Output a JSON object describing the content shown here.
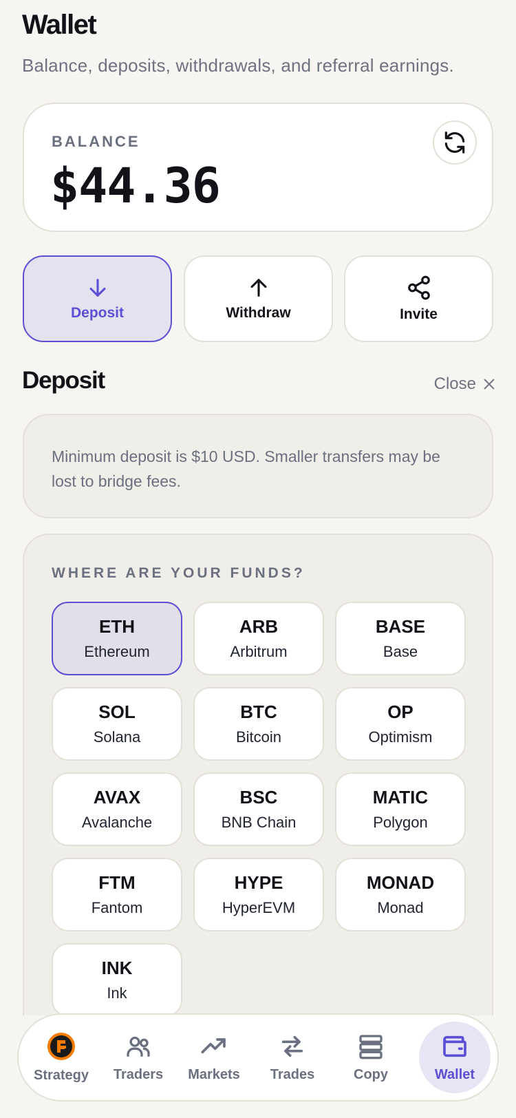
{
  "header": {
    "title": "Wallet",
    "subtitle": "Balance, deposits, withdrawals, and referral earnings."
  },
  "balance": {
    "label": "BALANCE",
    "amount": "$44.36",
    "refresh_icon": "refresh-icon"
  },
  "actions": [
    {
      "label": "Deposit",
      "icon": "arrow-down-icon",
      "active": true
    },
    {
      "label": "Withdraw",
      "icon": "arrow-up-icon",
      "active": false
    },
    {
      "label": "Invite",
      "icon": "share-icon",
      "active": false
    }
  ],
  "deposit": {
    "title": "Deposit",
    "close_label": "Close",
    "notice": "Minimum deposit is $10 USD. Smaller transfers may be lost to bridge fees.",
    "funds_label": "WHERE ARE YOUR FUNDS?",
    "chains": [
      {
        "symbol": "ETH",
        "name": "Ethereum",
        "selected": true
      },
      {
        "symbol": "ARB",
        "name": "Arbitrum",
        "selected": false
      },
      {
        "symbol": "BASE",
        "name": "Base",
        "selected": false
      },
      {
        "symbol": "SOL",
        "name": "Solana",
        "selected": false
      },
      {
        "symbol": "BTC",
        "name": "Bitcoin",
        "selected": false
      },
      {
        "symbol": "OP",
        "name": "Optimism",
        "selected": false
      },
      {
        "symbol": "AVAX",
        "name": "Avalanche",
        "selected": false
      },
      {
        "symbol": "BSC",
        "name": "BNB Chain",
        "selected": false
      },
      {
        "symbol": "MATIC",
        "name": "Polygon",
        "selected": false
      },
      {
        "symbol": "FTM",
        "name": "Fantom",
        "selected": false
      },
      {
        "symbol": "HYPE",
        "name": "HyperEVM",
        "selected": false
      },
      {
        "symbol": "MONAD",
        "name": "Monad",
        "selected": false
      },
      {
        "symbol": "INK",
        "name": "Ink",
        "selected": false
      }
    ]
  },
  "nav": [
    {
      "label": "Strategy",
      "icon": "strategy-logo-icon",
      "active": false
    },
    {
      "label": "Traders",
      "icon": "users-icon",
      "active": false
    },
    {
      "label": "Markets",
      "icon": "trending-up-icon",
      "active": false
    },
    {
      "label": "Trades",
      "icon": "swap-arrows-icon",
      "active": false
    },
    {
      "label": "Copy",
      "icon": "server-stack-icon",
      "active": false
    },
    {
      "label": "Wallet",
      "icon": "wallet-icon",
      "active": true
    }
  ],
  "colors": {
    "accent": "#5b4fd6",
    "background": "#f6f5f1",
    "muted_text": "#6b7080",
    "strategy_orange": "#f57c00"
  }
}
